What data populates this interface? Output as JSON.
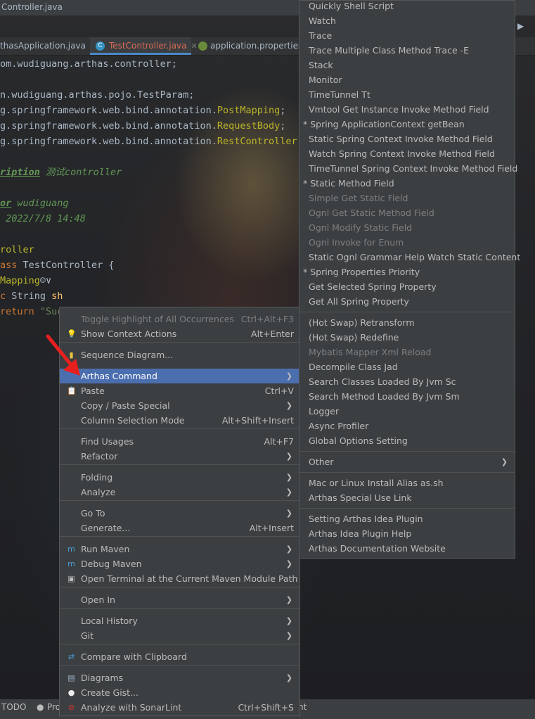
{
  "window": {
    "title": "Controller.java"
  },
  "tabs": [
    {
      "label": "thasApplication.java",
      "active": false
    },
    {
      "label": "TestController.java",
      "active": true
    },
    {
      "label": "application.properties",
      "active": false
    }
  ],
  "code_lines": [
    {
      "segments": [
        {
          "t": "om.wudiguang.arthas.controller;",
          "c": "c-pkg"
        }
      ]
    },
    {
      "segments": []
    },
    {
      "segments": [
        {
          "t": "n.wudiguang.arthas.pojo.TestParam;",
          "c": "c-pkg"
        }
      ]
    },
    {
      "segments": [
        {
          "t": "g.springframework.web.bind.annotation.",
          "c": "c-pkg"
        },
        {
          "t": "PostMapping",
          "c": "c-ann"
        },
        {
          "t": ";",
          "c": "c-pkg"
        }
      ]
    },
    {
      "segments": [
        {
          "t": "g.springframework.web.bind.annotation.",
          "c": "c-pkg"
        },
        {
          "t": "RequestBody",
          "c": "c-ann"
        },
        {
          "t": ";",
          "c": "c-pkg"
        }
      ]
    },
    {
      "segments": [
        {
          "t": "g.springframework.web.bind.annotation.",
          "c": "c-pkg"
        },
        {
          "t": "RestController",
          "c": "c-ann"
        },
        {
          "t": ";",
          "c": "c-pkg"
        }
      ]
    },
    {
      "segments": []
    },
    {
      "segments": [
        {
          "t": "ription",
          "c": "c-doctag"
        },
        {
          "t": " 测试controller",
          "c": "c-doc"
        }
      ]
    },
    {
      "segments": []
    },
    {
      "segments": [
        {
          "t": "or",
          "c": "c-doctag"
        },
        {
          "t": " wudiguang",
          "c": "c-doc"
        }
      ]
    },
    {
      "segments": [
        {
          "t": " 2022/7/8 14:48",
          "c": "c-doc"
        }
      ]
    },
    {
      "segments": []
    },
    {
      "segments": [
        {
          "t": "roller",
          "c": "c-ann"
        }
      ]
    },
    {
      "segments": [
        {
          "t": "ass ",
          "c": "c-kw"
        },
        {
          "t": "TestController {",
          "c": "c-pkg"
        }
      ]
    },
    {
      "segments": [
        {
          "t": "Mapping",
          "c": "c-ann"
        },
        {
          "t": "☺∨",
          "c": "c-pkg"
        }
      ]
    },
    {
      "segments": [
        {
          "t": "c ",
          "c": "c-kw"
        },
        {
          "t": "String ",
          "c": "c-pkg"
        },
        {
          "t": "sh",
          "c": "c-bold"
        }
      ]
    },
    {
      "segments": [
        {
          "t": "return ",
          "c": "c-kw"
        },
        {
          "t": "\"Succ",
          "c": "c-str"
        }
      ]
    }
  ],
  "status_bar": {
    "todo": "TODO",
    "problems": "Pro",
    "tail": "nt"
  },
  "context_menu": {
    "items": [
      {
        "type": "item",
        "label": "Toggle Highlight of All Occurrences",
        "shortcut": "Ctrl+Alt+F3",
        "disabled": true,
        "icon": ""
      },
      {
        "type": "item",
        "label": "Show Context Actions",
        "shortcut": "Alt+Enter",
        "icon": "bulb-icon"
      },
      {
        "type": "sep"
      },
      {
        "type": "item",
        "label": "Sequence Diagram...",
        "icon": "sequence-diagram-icon"
      },
      {
        "type": "item",
        "label": "Arthas Command",
        "submenu": true,
        "selected": true
      },
      {
        "type": "item",
        "label": "Paste",
        "shortcut": "Ctrl+V",
        "icon": "paste-icon"
      },
      {
        "type": "item",
        "label": "Copy / Paste Special",
        "submenu": true
      },
      {
        "type": "item",
        "label": "Column Selection Mode",
        "shortcut": "Alt+Shift+Insert"
      },
      {
        "type": "sep"
      },
      {
        "type": "item",
        "label": "Find Usages",
        "shortcut": "Alt+F7"
      },
      {
        "type": "item",
        "label": "Refactor",
        "submenu": true
      },
      {
        "type": "sep"
      },
      {
        "type": "item",
        "label": "Folding",
        "submenu": true
      },
      {
        "type": "item",
        "label": "Analyze",
        "submenu": true
      },
      {
        "type": "sep"
      },
      {
        "type": "item",
        "label": "Go To",
        "submenu": true
      },
      {
        "type": "item",
        "label": "Generate...",
        "shortcut": "Alt+Insert"
      },
      {
        "type": "sep"
      },
      {
        "type": "item",
        "label": "Run Maven",
        "submenu": true,
        "icon": "maven-icon"
      },
      {
        "type": "item",
        "label": "Debug Maven",
        "submenu": true,
        "icon": "maven-debug-icon"
      },
      {
        "type": "item",
        "label": "Open Terminal at the Current Maven Module Path",
        "icon": "terminal-icon"
      },
      {
        "type": "sep"
      },
      {
        "type": "item",
        "label": "Open In",
        "submenu": true
      },
      {
        "type": "sep"
      },
      {
        "type": "item",
        "label": "Local History",
        "submenu": true
      },
      {
        "type": "item",
        "label": "Git",
        "submenu": true
      },
      {
        "type": "sep"
      },
      {
        "type": "item",
        "label": "Compare with Clipboard",
        "icon": "compare-icon"
      },
      {
        "type": "sep"
      },
      {
        "type": "item",
        "label": "Diagrams",
        "submenu": true,
        "icon": "diagram-icon"
      },
      {
        "type": "item",
        "label": "Create Gist...",
        "icon": "github-icon"
      },
      {
        "type": "item",
        "label": "Analyze with SonarLint",
        "shortcut": "Ctrl+Shift+S",
        "icon": "sonarlint-icon"
      }
    ]
  },
  "arthas_submenu": {
    "items": [
      {
        "type": "item",
        "label": "Quickly Shell Script"
      },
      {
        "type": "item",
        "label": "Watch"
      },
      {
        "type": "item",
        "label": "Trace"
      },
      {
        "type": "item",
        "label": "Trace Multiple Class Method Trace -E"
      },
      {
        "type": "item",
        "label": "Stack"
      },
      {
        "type": "item",
        "label": "Monitor"
      },
      {
        "type": "item",
        "label": "TimeTunnel Tt"
      },
      {
        "type": "item",
        "label": "Vmtool Get Instance Invoke Method Field"
      },
      {
        "type": "item",
        "label": "* Spring ApplicationContext getBean",
        "star": true
      },
      {
        "type": "item",
        "label": "Static Spring Context Invoke  Method Field"
      },
      {
        "type": "item",
        "label": "Watch Spring Context Invoke Method Field"
      },
      {
        "type": "item",
        "label": "TimeTunnel Spring Context Invoke Method Field"
      },
      {
        "type": "item",
        "label": "*  Static Method Field",
        "star": true
      },
      {
        "type": "item",
        "label": "Simple Get Static Field",
        "disabled": true
      },
      {
        "type": "item",
        "label": "Ognl Get Static Method Field",
        "disabled": true
      },
      {
        "type": "item",
        "label": "Ognl Modify Static Field",
        "disabled": true
      },
      {
        "type": "item",
        "label": "Ognl Invoke for Enum",
        "disabled": true
      },
      {
        "type": "item",
        "label": "Static Ognl Grammar Help Watch Static Content"
      },
      {
        "type": "item",
        "label": "*  Spring Properties Priority",
        "star": true
      },
      {
        "type": "item",
        "label": "Get Selected Spring Property"
      },
      {
        "type": "item",
        "label": "Get All Spring Property"
      },
      {
        "type": "sep"
      },
      {
        "type": "item",
        "label": "(Hot Swap) Retransform"
      },
      {
        "type": "item",
        "label": "(Hot Swap) Redefine"
      },
      {
        "type": "item",
        "label": "Mybatis Mapper Xml Reload",
        "disabled": true
      },
      {
        "type": "item",
        "label": "Decompile Class Jad"
      },
      {
        "type": "item",
        "label": "Search Classes Loaded By Jvm Sc"
      },
      {
        "type": "item",
        "label": "Search Method Loaded By Jvm Sm"
      },
      {
        "type": "item",
        "label": "Logger"
      },
      {
        "type": "item",
        "label": "Async Profiler"
      },
      {
        "type": "item",
        "label": "Global Options Setting"
      },
      {
        "type": "sep"
      },
      {
        "type": "item",
        "label": "Other",
        "submenu": true
      },
      {
        "type": "sep"
      },
      {
        "type": "item",
        "label": "Mac or Linux Install Alias as.sh"
      },
      {
        "type": "item",
        "label": "Arthas Special Use Link"
      },
      {
        "type": "sep"
      },
      {
        "type": "item",
        "label": "Setting Arthas Idea Plugin"
      },
      {
        "type": "item",
        "label": "Arthas Idea Plugin Help"
      },
      {
        "type": "item",
        "label": "Arthas Documentation Website"
      }
    ]
  },
  "colors": {
    "menu_bg": "#3c3f41",
    "selection": "#4b6eaf",
    "disabled_text": "#7d7f81",
    "annotation": "#bbb529",
    "keyword": "#cc7832",
    "arrow": "#e8201e"
  }
}
